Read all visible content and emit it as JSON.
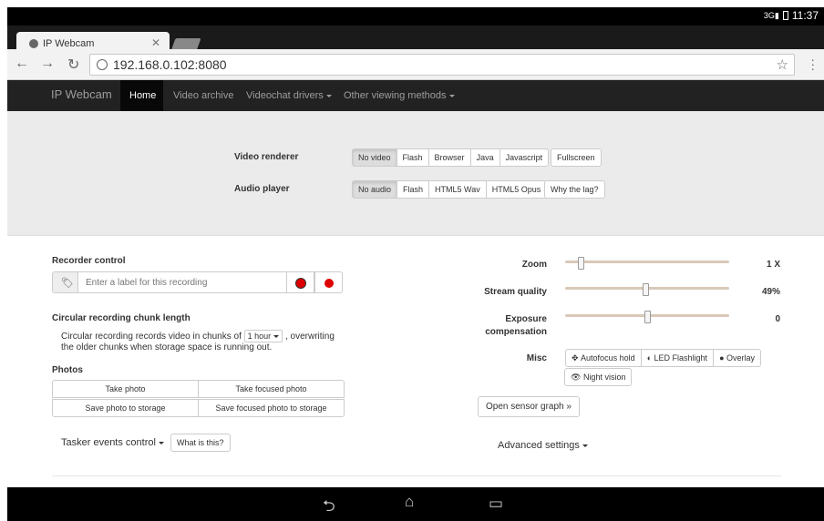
{
  "status": {
    "time": "11:37"
  },
  "browser": {
    "tab_title": "IP Webcam",
    "url": "192.168.0.102:8080",
    "back": "←",
    "forward": "→",
    "reload": "↻",
    "star": "☆",
    "close": "✕"
  },
  "nav": {
    "brand": "IP Webcam",
    "items": [
      "Home",
      "Video archive",
      "Videochat drivers",
      "Other viewing methods"
    ]
  },
  "video_renderer": {
    "label": "Video renderer",
    "options": [
      "No video",
      "Flash",
      "Browser",
      "Java",
      "Javascript"
    ],
    "fullscreen": "Fullscreen",
    "selected": "No video"
  },
  "audio_player": {
    "label": "Audio player",
    "options": [
      "No audio",
      "Flash",
      "HTML5 Wav",
      "HTML5 Opus"
    ],
    "why_lag": "Why the lag?",
    "selected": "No audio"
  },
  "recorder": {
    "title": "Recorder control",
    "placeholder": "Enter a label for this recording"
  },
  "chunk": {
    "title": "Circular recording chunk length",
    "text_before": "Circular recording records video in chunks of",
    "select_value": "1 hour",
    "text_after": ", overwriting",
    "text_line2": "the older chunks when storage space is running out."
  },
  "photos": {
    "title": "Photos",
    "take_photo": "Take photo",
    "take_focused": "Take focused photo",
    "save_photo": "Save photo to storage",
    "save_focused": "Save focused photo to storage"
  },
  "tasker": {
    "label": "Tasker events control",
    "what": "What is this?"
  },
  "sliders": {
    "zoom": {
      "label": "Zoom",
      "value": "1 X",
      "level": 0.08
    },
    "quality": {
      "label": "Stream quality",
      "value": "49%",
      "level": 0.49
    },
    "exposure": {
      "label1": "Exposure",
      "label2": "compensation",
      "value": "0",
      "level": 0.5
    }
  },
  "misc": {
    "label": "Misc",
    "autofocus": "Autofocus hold",
    "flashlight": "LED Flashlight",
    "overlay": "Overlay",
    "night": "Night vision"
  },
  "sensor_btn": "Open sensor graph »",
  "advanced": "Advanced settings"
}
